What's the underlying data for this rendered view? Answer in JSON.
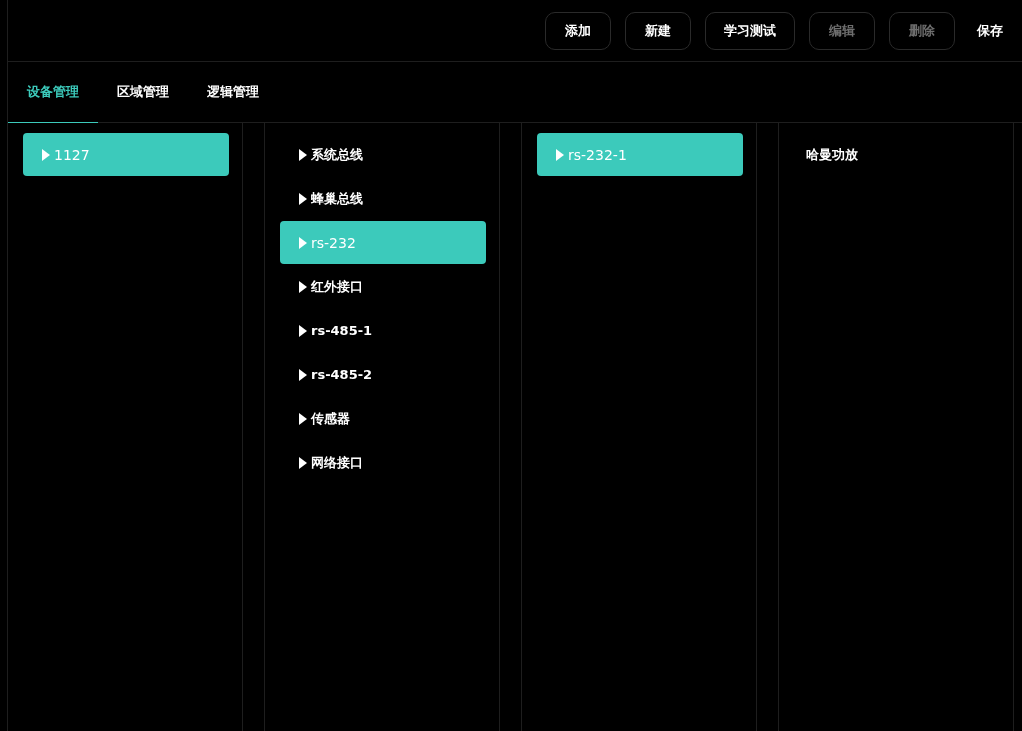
{
  "toolbar": {
    "buttons": [
      {
        "label": "添加",
        "kind": "outlined",
        "disabled": false
      },
      {
        "label": "新建",
        "kind": "outlined",
        "disabled": false
      },
      {
        "label": "学习测试",
        "kind": "outlined",
        "disabled": false
      },
      {
        "label": "编辑",
        "kind": "outlined",
        "disabled": true
      },
      {
        "label": "删除",
        "kind": "outlined",
        "disabled": true
      },
      {
        "label": "保存",
        "kind": "text",
        "disabled": false
      }
    ]
  },
  "tabs": [
    {
      "label": "设备管理",
      "selected": true
    },
    {
      "label": "区域管理",
      "selected": false
    },
    {
      "label": "逻辑管理",
      "selected": false
    }
  ],
  "columns": [
    {
      "items": [
        {
          "label": "1127",
          "expandable": true,
          "selected": true
        }
      ]
    },
    {
      "items": [
        {
          "label": "系统总线",
          "expandable": true,
          "selected": false
        },
        {
          "label": "蜂巢总线",
          "expandable": true,
          "selected": false
        },
        {
          "label": "rs-232",
          "expandable": true,
          "selected": true
        },
        {
          "label": "红外接口",
          "expandable": true,
          "selected": false
        },
        {
          "label": "rs-485-1",
          "expandable": true,
          "selected": false
        },
        {
          "label": "rs-485-2",
          "expandable": true,
          "selected": false
        },
        {
          "label": "传感器",
          "expandable": true,
          "selected": false
        },
        {
          "label": "网络接口",
          "expandable": true,
          "selected": false
        }
      ]
    },
    {
      "items": [
        {
          "label": "rs-232-1",
          "expandable": true,
          "selected": true
        }
      ]
    },
    {
      "items": [
        {
          "label": "哈曼功放",
          "expandable": false,
          "selected": false
        }
      ]
    }
  ]
}
